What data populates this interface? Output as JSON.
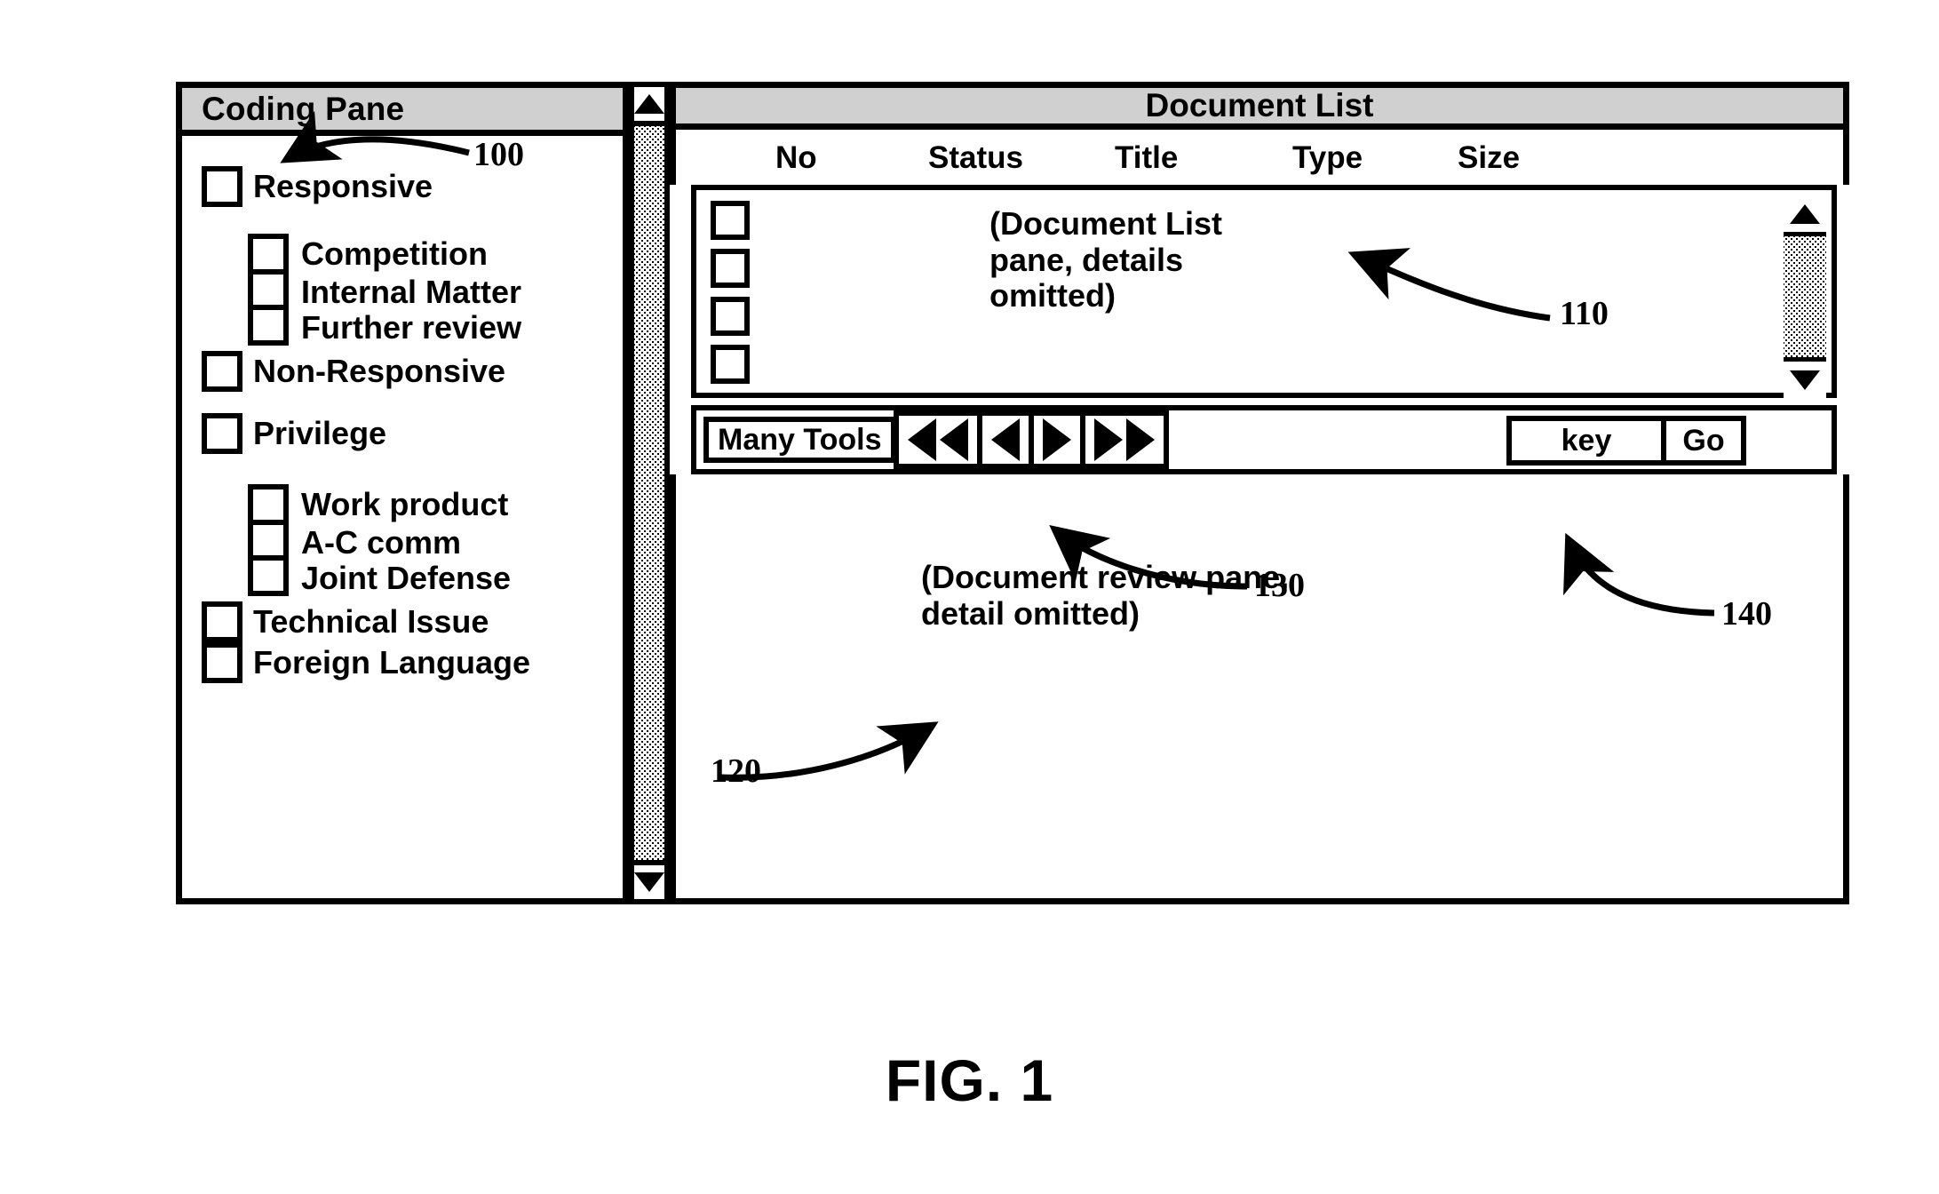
{
  "figure": {
    "caption": "FIG. 1"
  },
  "coding_pane": {
    "title": "Coding Pane",
    "items": [
      {
        "label": "Responsive",
        "level": 0
      },
      {
        "label": "Competition",
        "level": 1
      },
      {
        "label": "Internal Matter",
        "level": 1
      },
      {
        "label": "Further review",
        "level": 1
      },
      {
        "label": "Non-Responsive",
        "level": 0
      },
      {
        "label": "Privilege",
        "level": 0
      },
      {
        "label": "Work product",
        "level": 1
      },
      {
        "label": "A-C comm",
        "level": 1
      },
      {
        "label": "Joint Defense",
        "level": 1
      },
      {
        "label": "Technical Issue",
        "level": 0
      },
      {
        "label": "Foreign Language",
        "level": 0
      }
    ],
    "scrollbar": {
      "up_icon": "triangle-up-icon",
      "down_icon": "triangle-down-icon"
    }
  },
  "document_list": {
    "title": "Document List",
    "columns": [
      "No",
      "Status",
      "Title",
      "Type",
      "Size"
    ],
    "row_count": 4,
    "placeholder_note": "(Document List\npane, details\nomitted)",
    "scrollbar": {
      "up_icon": "triangle-up-icon",
      "down_icon": "triangle-down-icon"
    }
  },
  "toolbar": {
    "many_tools_label": "Many Tools",
    "nav_buttons": [
      {
        "name": "first-record-button",
        "icon": "double-left-arrow-icon"
      },
      {
        "name": "previous-record-button",
        "icon": "left-arrow-icon"
      },
      {
        "name": "next-record-button",
        "icon": "right-arrow-icon"
      },
      {
        "name": "last-record-button",
        "icon": "double-right-arrow-icon"
      }
    ],
    "key_field_value": "key",
    "go_label": "Go"
  },
  "review_pane": {
    "placeholder_note": "(Document review pane,\ndetail omitted)"
  },
  "callouts": {
    "ref_100": "100",
    "ref_110": "110",
    "ref_120": "120",
    "ref_130": "130",
    "ref_140": "140"
  },
  "colors": {
    "line": "#000000",
    "titlebar_fill": "#d0d0d0",
    "background": "#ffffff"
  }
}
